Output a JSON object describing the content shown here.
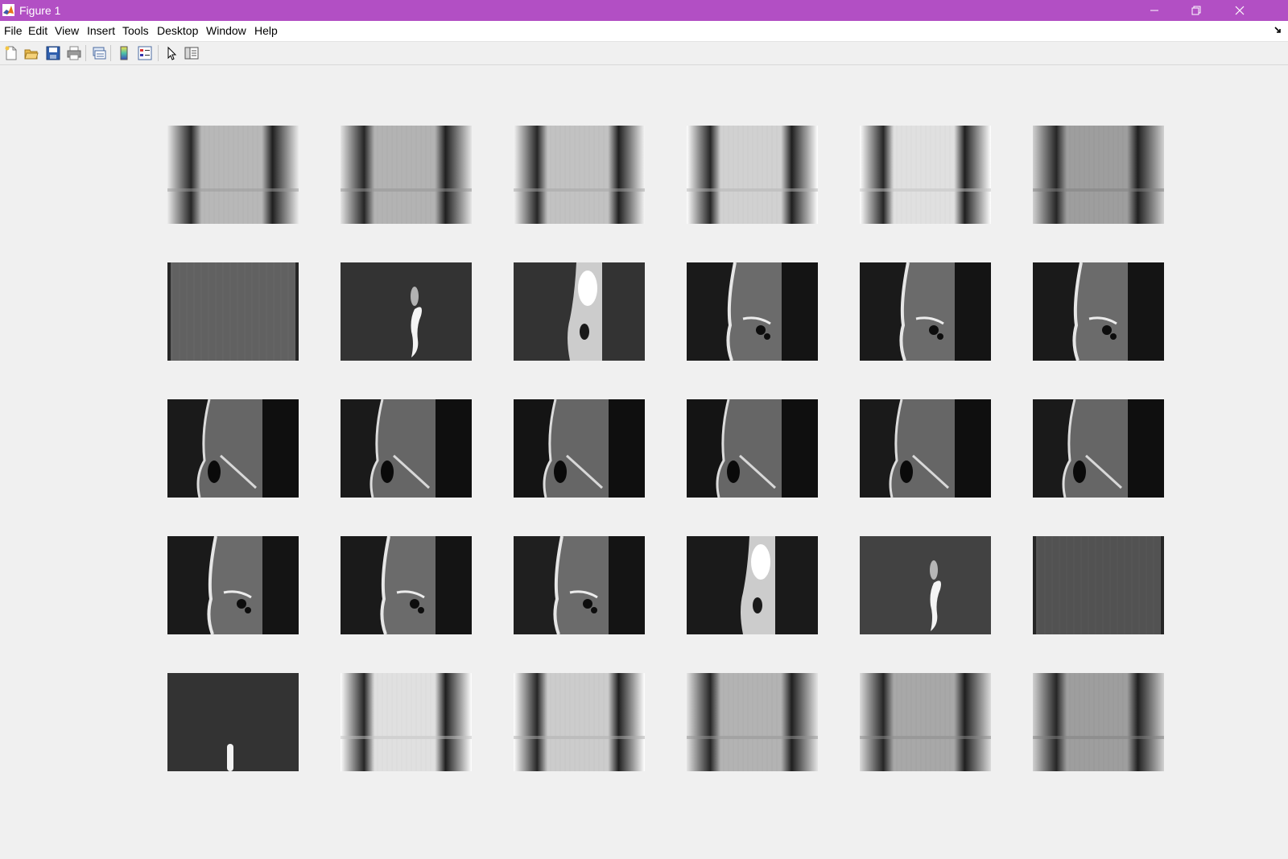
{
  "window": {
    "title": "Figure 1",
    "titlebar_color": "#b24fc4",
    "controls": [
      "minimize-icon",
      "restore-icon",
      "close-icon"
    ]
  },
  "menu": {
    "items": [
      {
        "label": "File",
        "mnemonic": "F"
      },
      {
        "label": "Edit",
        "mnemonic": "E"
      },
      {
        "label": "View",
        "mnemonic": "V"
      },
      {
        "label": "Insert",
        "mnemonic": "I"
      },
      {
        "label": "Tools",
        "mnemonic": "T"
      },
      {
        "label": "Desktop",
        "mnemonic": "D"
      },
      {
        "label": "Window",
        "mnemonic": "W"
      },
      {
        "label": "Help",
        "mnemonic": "H"
      }
    ]
  },
  "toolbar": {
    "buttons": [
      "new-figure-icon",
      "open-file-icon",
      "save-figure-icon",
      "print-figure-icon",
      "link-plot-icon",
      "insert-colorbar-icon",
      "insert-legend-icon",
      "edit-plot-arrow-icon",
      "property-inspector-icon"
    ]
  },
  "figure": {
    "rows": 5,
    "cols": 6,
    "subplots": [
      {
        "style": "bright-bands",
        "level": 0.72
      },
      {
        "style": "bright-bands",
        "level": 0.7
      },
      {
        "style": "bright-bands",
        "level": 0.76
      },
      {
        "style": "bright-bands",
        "level": 0.82
      },
      {
        "style": "bright-bands",
        "level": 0.88
      },
      {
        "style": "bright-bands",
        "level": 0.62
      },
      {
        "style": "gray-uniform",
        "level": 0.38
      },
      {
        "style": "dark-ear",
        "level": 0.2
      },
      {
        "style": "head-slice",
        "level": 0.2
      },
      {
        "style": "skull-sinus",
        "level": 0.1
      },
      {
        "style": "skull-sinus",
        "level": 0.1
      },
      {
        "style": "skull-sinus",
        "level": 0.1
      },
      {
        "style": "skull-face",
        "level": 0.1
      },
      {
        "style": "skull-face",
        "level": 0.1
      },
      {
        "style": "skull-face",
        "level": 0.08
      },
      {
        "style": "skull-face",
        "level": 0.08
      },
      {
        "style": "skull-face",
        "level": 0.1
      },
      {
        "style": "skull-face",
        "level": 0.1
      },
      {
        "style": "skull-sinus",
        "level": 0.1
      },
      {
        "style": "skull-sinus",
        "level": 0.1
      },
      {
        "style": "skull-sinus",
        "level": 0.12
      },
      {
        "style": "head-slice",
        "level": 0.1
      },
      {
        "style": "dark-ear",
        "level": 0.26
      },
      {
        "style": "gray-uniform",
        "level": 0.32
      },
      {
        "style": "dark-uniform",
        "level": 0.2
      },
      {
        "style": "bright-bands",
        "level": 0.88
      },
      {
        "style": "bright-bands",
        "level": 0.8
      },
      {
        "style": "bright-bands",
        "level": 0.7
      },
      {
        "style": "bright-bands",
        "level": 0.66
      },
      {
        "style": "bright-bands",
        "level": 0.62
      }
    ]
  }
}
